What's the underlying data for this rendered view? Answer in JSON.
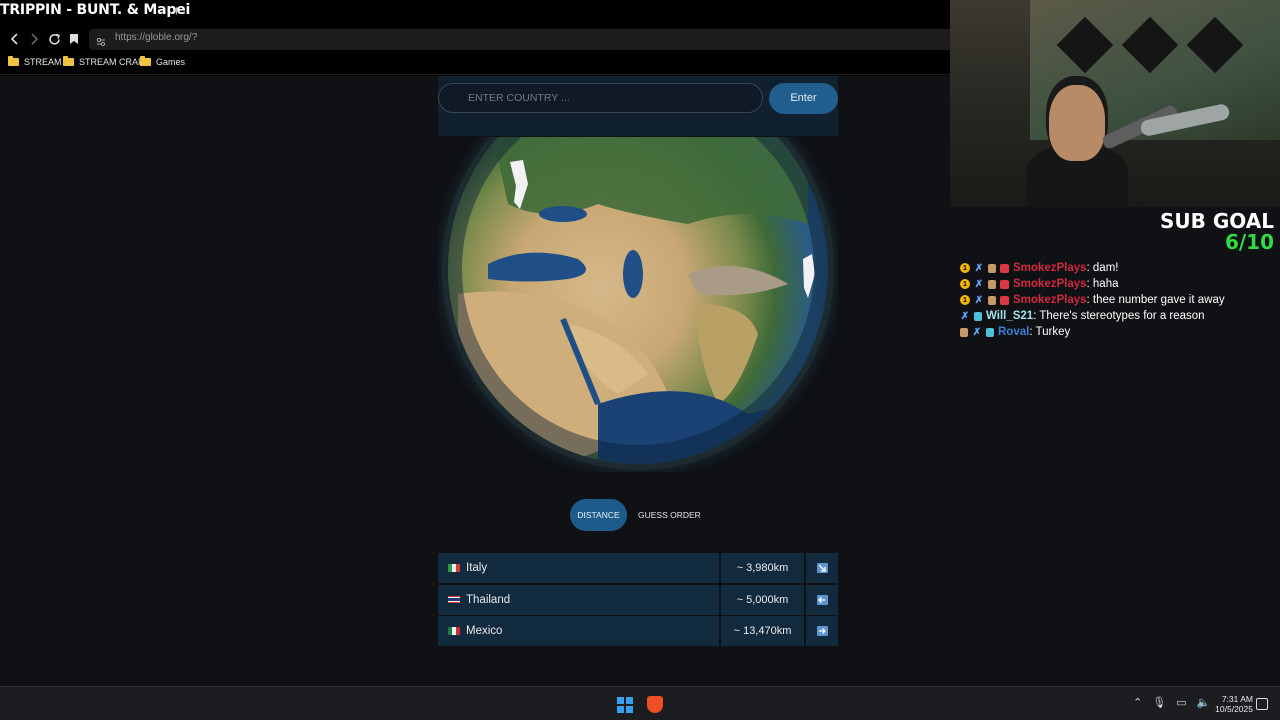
{
  "stream": {
    "title": "TRIPPIN - BUNT. & Mapei"
  },
  "browser": {
    "new_tab": "+",
    "url": "https://globle.org/?",
    "bookmarks": [
      "STREAM",
      "STREAM CRAP",
      "Games"
    ]
  },
  "game": {
    "input_placeholder": "ENTER COUNTRY ...",
    "enter_label": "Enter",
    "tabs": {
      "distance": "DISTANCE",
      "guess_order": "GUESS ORDER"
    },
    "guesses": [
      {
        "country": "Italy",
        "distance": "~ 3,980km",
        "direction": "down-right"
      },
      {
        "country": "Thailand",
        "distance": "~ 5,000km",
        "direction": "left"
      },
      {
        "country": "Mexico",
        "distance": "~ 13,470km",
        "direction": "right"
      }
    ]
  },
  "overlay": {
    "sub_goal_label": "SUB GOAL",
    "sub_goal_count": "6/10",
    "chat": [
      {
        "user": "SmokezPlays",
        "message": ": dam!",
        "color": "#d0283e"
      },
      {
        "user": "SmokezPlays",
        "message": ": haha",
        "color": "#d0283e"
      },
      {
        "user": "SmokezPlays",
        "message": ": thee number gave it away",
        "color": "#d0283e"
      },
      {
        "user": "Will_S21",
        "message": ": There's stereotypes for a reason",
        "color": "#9fe3e9"
      },
      {
        "user": "Roval",
        "message": ": Turkey",
        "color": "#3b7fd9"
      }
    ]
  },
  "taskbar": {
    "time": "7:31 AM",
    "date": "10/5/2025"
  },
  "colors": {
    "accent": "#1f5e8d",
    "row_bg": "#122a3e",
    "sub_goal_count": "#2fdc45"
  }
}
